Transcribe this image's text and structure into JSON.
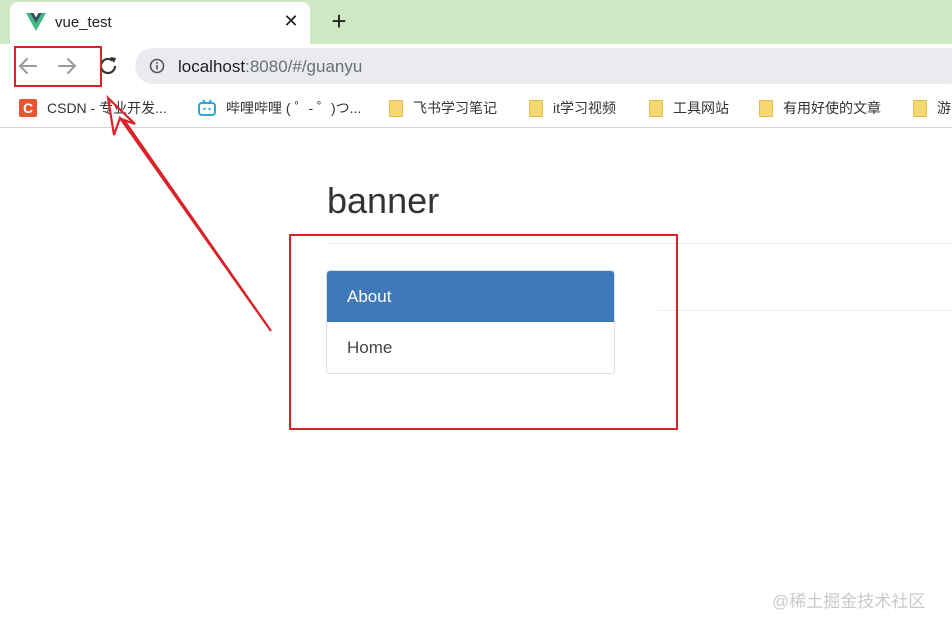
{
  "browser": {
    "tab_title": "vue_test",
    "tab_close_glyph": "✕",
    "new_tab_glyph": "+",
    "url_host": "localhost",
    "url_rest": ":8080/#/guanyu",
    "bookmarks": [
      {
        "label": "CSDN - 专业开发...",
        "icon": "csdn-icon",
        "icon_text": "C"
      },
      {
        "label": "哔哩哔哩 ( ゜- ゜)つ...",
        "icon": "bilibili-icon"
      },
      {
        "label": "飞书学习笔记",
        "icon": "folder-icon"
      },
      {
        "label": "it学习视频",
        "icon": "folder-icon"
      },
      {
        "label": "工具网站",
        "icon": "folder-icon"
      },
      {
        "label": "有用好使的文章",
        "icon": "folder-icon"
      },
      {
        "label": "游",
        "icon": "folder-icon"
      }
    ]
  },
  "page": {
    "banner": "banner",
    "menu": [
      {
        "label": "About",
        "active": true
      },
      {
        "label": "Home",
        "active": false
      }
    ]
  },
  "watermark": "@稀土掘金技术社区",
  "colors": {
    "tabstrip": "#cfe8c4",
    "menu_active": "#4079b7",
    "annotation": "#d8232a",
    "csdn": "#e8542e",
    "bilibili": "#2aa6d8",
    "vue_green": "#41b883",
    "vue_dark": "#35495e"
  }
}
